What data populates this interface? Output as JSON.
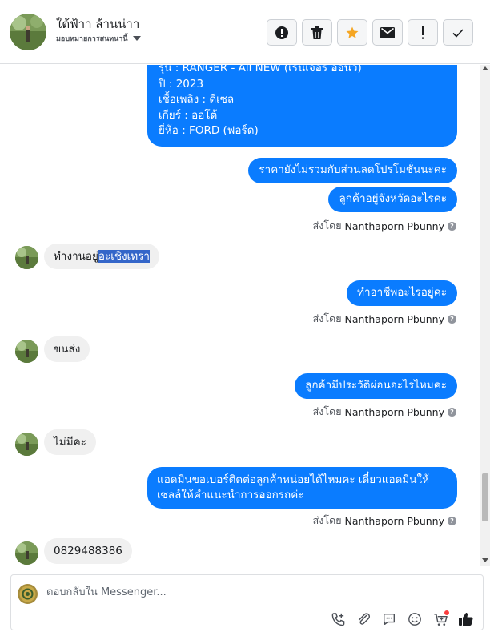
{
  "header": {
    "contact_name": "ใต้ฟ้าา ล้านน่าา",
    "assign_label": "มอบหมายการสนทนานี้",
    "actions": [
      {
        "name": "mark-spam-button",
        "icon": "alert-circle-icon"
      },
      {
        "name": "delete-button",
        "icon": "trash-icon"
      },
      {
        "name": "star-button",
        "icon": "star-icon"
      },
      {
        "name": "mark-unread-button",
        "icon": "envelope-icon"
      },
      {
        "name": "follow-up-button",
        "icon": "exclamation-icon"
      },
      {
        "name": "mark-done-button",
        "icon": "checkmark-icon"
      }
    ]
  },
  "messages": {
    "car_details": {
      "model": "รุ่น : RANGER - All NEW (เรนเจอร์ ออนิว)",
      "year": "ปี : 2023",
      "fuel": "เชื้อเพลิง : ดีเซล",
      "gear": "เกียร์ : ออโต้",
      "brand": "ยี่ห้อ : FORD (ฟอร์ด)"
    },
    "out1": "ราคายังไม่รวมกับส่วนลดโปรโมชั่นนะคะ",
    "out2": "ลูกค้าอยู่จังหวัดอะไรคะ",
    "in1_part1": "ทำงานอยู่",
    "in1_part2": "อะเชิงเทรา",
    "out3": "ทำอาชีพอะไรอยู่คะ",
    "in2": "ขนส่ง",
    "out4": "ลูกค้ามีประวัติผ่อนอะไรไหมคะ",
    "in3": "ไม่มีคะ",
    "out5_line1": "แอดมินขอเบอร์ติดต่อลูกค้าหน่อยได้ไหมคะ เดี๋ยวแอดมินให้",
    "out5_line2": "เซลล์ให้คำแนะนำการออกรถค่ะ",
    "in4": "0829488386"
  },
  "sent_by": {
    "prefix": "ส่งโดย",
    "agent": "Nanthaporn Pbunny",
    "help_icon": "?"
  },
  "composer": {
    "placeholder": "ตอบกลับใน Messenger...",
    "tools": [
      "call-add-icon",
      "paperclip-icon",
      "saved-reply-icon",
      "emoji-icon",
      "cart-icon",
      "thumbs-up-icon"
    ]
  },
  "colors": {
    "outgoing_bubble": "#0a7cff",
    "incoming_bubble": "#f0f0f0",
    "star": "#f5a623",
    "highlight": "#3466c9"
  }
}
